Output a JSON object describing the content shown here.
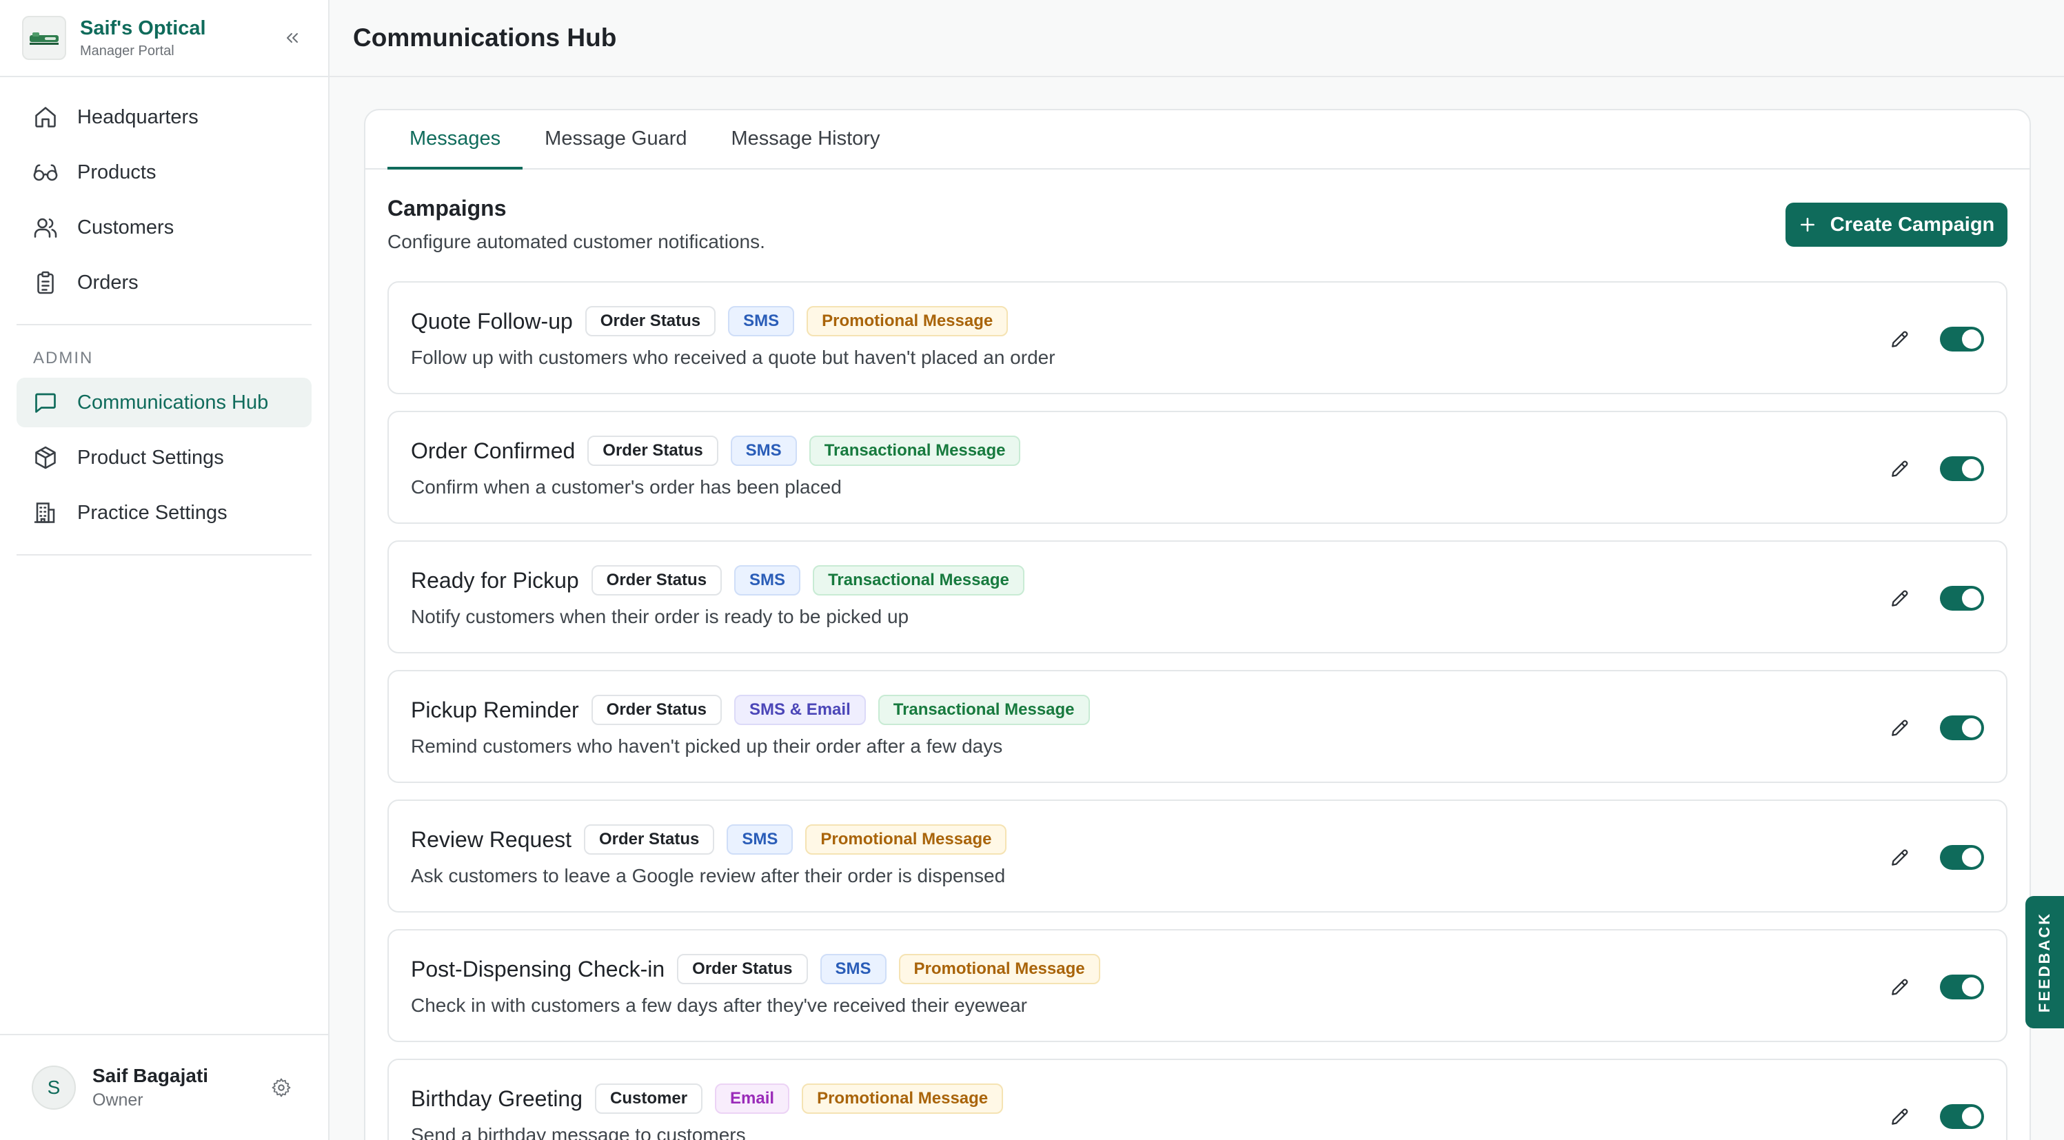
{
  "brand": {
    "name": "Saif's Optical",
    "subtitle": "Manager Portal"
  },
  "nav": {
    "items": [
      {
        "label": "Headquarters",
        "icon": "home-icon"
      },
      {
        "label": "Products",
        "icon": "glasses-icon"
      },
      {
        "label": "Customers",
        "icon": "users-icon"
      },
      {
        "label": "Orders",
        "icon": "clipboard-icon"
      }
    ],
    "admin_heading": "ADMIN",
    "admin_items": [
      {
        "label": "Communications Hub",
        "icon": "message-icon",
        "active": true
      },
      {
        "label": "Product Settings",
        "icon": "package-icon"
      },
      {
        "label": "Practice Settings",
        "icon": "building-icon"
      }
    ]
  },
  "user": {
    "initial": "S",
    "name": "Saif Bagajati",
    "role": "Owner"
  },
  "header": {
    "title": "Communications Hub"
  },
  "tabs": [
    {
      "label": "Messages",
      "active": true
    },
    {
      "label": "Message Guard"
    },
    {
      "label": "Message History"
    }
  ],
  "section": {
    "title": "Campaigns",
    "subtitle": "Configure automated customer notifications.",
    "create_label": "Create Campaign"
  },
  "campaigns": [
    {
      "name": "Quote Follow-up",
      "trigger": "Order Status",
      "channel": "SMS",
      "type": "Promotional Message",
      "description": "Follow up with customers who received a quote but haven't placed an order",
      "enabled": true
    },
    {
      "name": "Order Confirmed",
      "trigger": "Order Status",
      "channel": "SMS",
      "type": "Transactional Message",
      "description": "Confirm when a customer's order has been placed",
      "enabled": true
    },
    {
      "name": "Ready for Pickup",
      "trigger": "Order Status",
      "channel": "SMS",
      "type": "Transactional Message",
      "description": "Notify customers when their order is ready to be picked up",
      "enabled": true
    },
    {
      "name": "Pickup Reminder",
      "trigger": "Order Status",
      "channel": "SMS & Email",
      "type": "Transactional Message",
      "description": "Remind customers who haven't picked up their order after a few days",
      "enabled": true
    },
    {
      "name": "Review Request",
      "trigger": "Order Status",
      "channel": "SMS",
      "type": "Promotional Message",
      "description": "Ask customers to leave a Google review after their order is dispensed",
      "enabled": true
    },
    {
      "name": "Post-Dispensing Check-in",
      "trigger": "Order Status",
      "channel": "SMS",
      "type": "Promotional Message",
      "description": "Check in with customers a few days after they've received their eyewear",
      "enabled": true
    },
    {
      "name": "Birthday Greeting",
      "trigger": "Customer",
      "channel": "Email",
      "type": "Promotional Message",
      "description": "Send a birthday message to customers",
      "enabled": true
    }
  ],
  "feedback": {
    "label": "FEEDBACK"
  },
  "colors": {
    "accent": "#0f6b5b"
  }
}
